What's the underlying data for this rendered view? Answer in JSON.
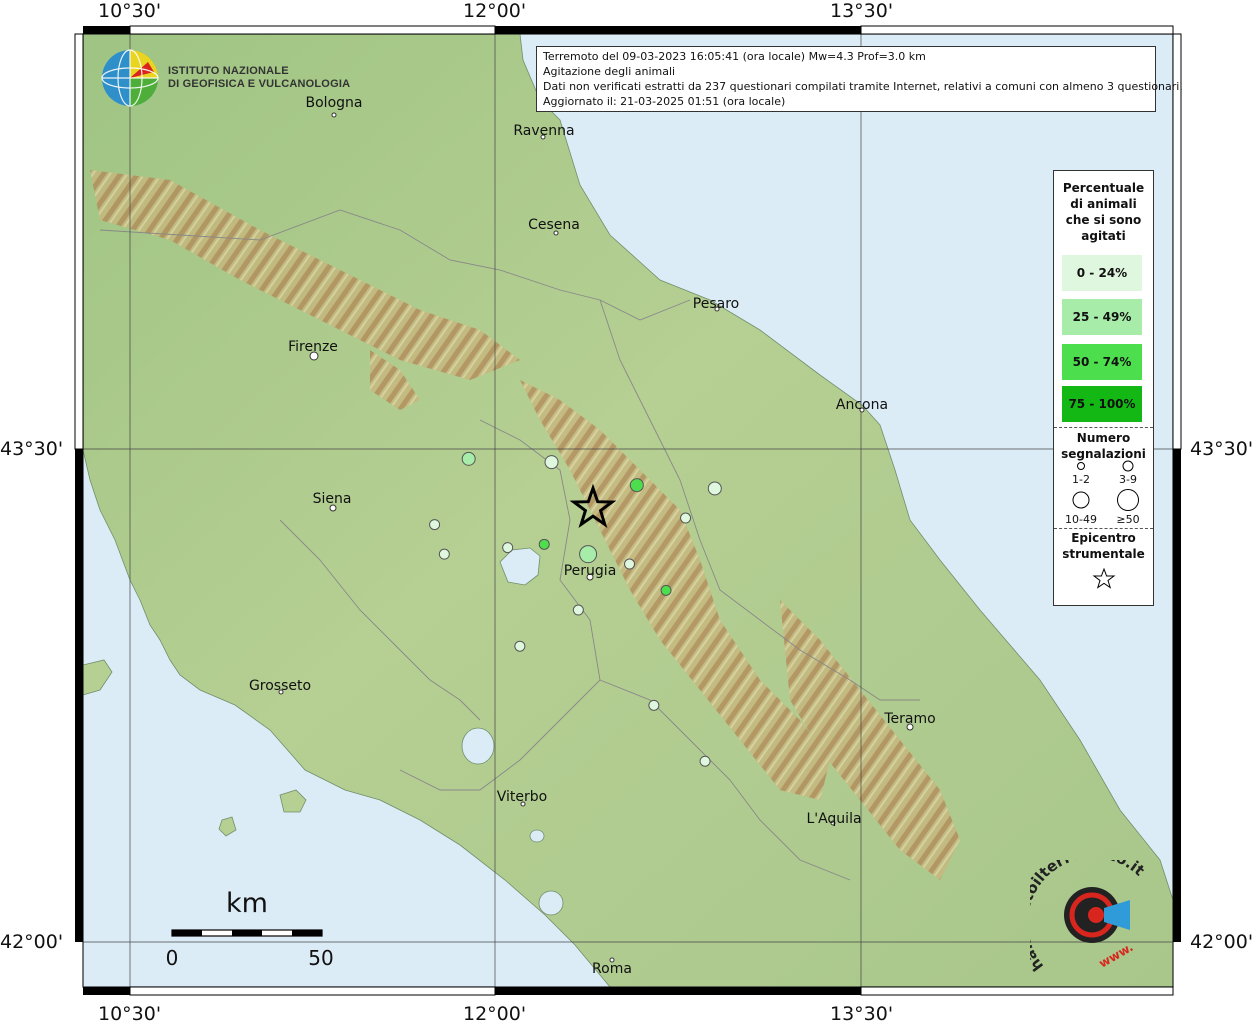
{
  "header": {
    "logo": {
      "name": "ingv-logo",
      "line1": "ISTITUTO NAZIONALE",
      "line2": "DI GEOFISICA E VULCANOLOGIA"
    },
    "info": {
      "line1": "Terremoto del 09-03-2023 16:05:41 (ora locale) Mw=4.3 Prof=3.0 km",
      "line2": "Agitazione degli animali",
      "line3": "Dati non verificati estratti da 237 questionari compilati tramite Internet, relativi a comuni con almeno 3 questionari.",
      "line4": "Aggiornato il: 21-03-2025 01:51 (ora locale)"
    }
  },
  "coords": {
    "lon_1030": "10°30'",
    "lon_1200": "12°00'",
    "lon_1330": "13°30'",
    "lat_4330": "43°30'",
    "lat_4200": "42°00'"
  },
  "cities": {
    "bologna": "Bologna",
    "ravenna": "Ravenna",
    "cesena": "Cesena",
    "pesaro": "Pesaro",
    "firenze": "Firenze",
    "ancona": "Ancona",
    "siena": "Siena",
    "perugia": "Perugia",
    "grosseto": "Grosseto",
    "teramo": "Teramo",
    "viterbo": "Viterbo",
    "laquila": "L'Aquila",
    "roma": "Roma"
  },
  "legend": {
    "title": [
      "Percentuale",
      "di animali",
      "che si sono",
      "agitati"
    ],
    "classes": [
      {
        "label": "0 - 24%",
        "color": "#dff7df"
      },
      {
        "label": "25 - 49%",
        "color": "#a8ecaa"
      },
      {
        "label": "50 - 74%",
        "color": "#4cde4c"
      },
      {
        "label": "75 - 100%",
        "color": "#14b814"
      }
    ],
    "count_title": [
      "Numero",
      "segnalazioni"
    ],
    "count_classes": [
      "1-2",
      "3-9",
      "10-49",
      "≥50"
    ],
    "epicenter_title": [
      "Epicentro",
      "strumentale"
    ]
  },
  "scale": {
    "unit": "km",
    "start": "0",
    "end": "50"
  },
  "watermark": {
    "name": "haisentitoilterremoto-logo",
    "text": "haisentitoilterremoto.it",
    "text2": "www."
  },
  "colors": {
    "sea": "#dcecf7",
    "land_low": "#a9c98a",
    "land_mid": "#cfc18c",
    "mountain": "#b98d5e",
    "class_0": "#dff7df",
    "class_1": "#a8ecaa",
    "class_2": "#4cde4c",
    "class_3": "#14b814"
  },
  "observations": [
    {
      "lon": 11.89,
      "lat": 43.47,
      "class": 1,
      "count": "3-9"
    },
    {
      "lon": 12.23,
      "lat": 43.46,
      "class": 0,
      "count": "3-9"
    },
    {
      "lon": 12.58,
      "lat": 43.39,
      "class": 2,
      "count": "3-9"
    },
    {
      "lon": 12.9,
      "lat": 43.38,
      "class": 0,
      "count": "3-9"
    },
    {
      "lon": 12.78,
      "lat": 43.29,
      "class": 0,
      "count": "1-2"
    },
    {
      "lon": 11.75,
      "lat": 43.27,
      "class": 0,
      "count": "1-2"
    },
    {
      "lon": 11.79,
      "lat": 43.18,
      "class": 0,
      "count": "1-2"
    },
    {
      "lon": 12.05,
      "lat": 43.2,
      "class": 0,
      "count": "1-2"
    },
    {
      "lon": 12.2,
      "lat": 43.21,
      "class": 2,
      "count": "1-2"
    },
    {
      "lon": 12.38,
      "lat": 43.18,
      "class": 1,
      "count": "10-49"
    },
    {
      "lon": 12.55,
      "lat": 43.15,
      "class": 0,
      "count": "1-2"
    },
    {
      "lon": 12.7,
      "lat": 43.07,
      "class": 2,
      "count": "1-2"
    },
    {
      "lon": 12.34,
      "lat": 43.01,
      "class": 0,
      "count": "1-2"
    },
    {
      "lon": 12.1,
      "lat": 42.9,
      "class": 0,
      "count": "1-2"
    },
    {
      "lon": 12.65,
      "lat": 42.72,
      "class": 0,
      "count": "1-2"
    },
    {
      "lon": 12.86,
      "lat": 42.55,
      "class": 0,
      "count": "1-2"
    }
  ],
  "epicenter": {
    "lon": 12.4,
    "lat": 43.32
  }
}
